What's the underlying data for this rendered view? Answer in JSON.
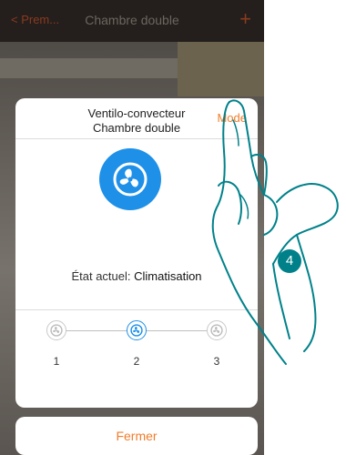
{
  "header": {
    "back_label": "< Prem...",
    "title": "Chambre double",
    "add_label": "+"
  },
  "dialog": {
    "title_line1": "Ventilo-convecteur",
    "title_line2": "Chambre double",
    "mode_label": "Mode",
    "status_label": "État actuel:",
    "status_value": "Climatisation",
    "speeds": [
      {
        "label": "1",
        "selected": false
      },
      {
        "label": "2",
        "selected": true
      },
      {
        "label": "3",
        "selected": false
      }
    ]
  },
  "close_label": "Fermer",
  "step_number": "4",
  "colors": {
    "accent": "#f07d2b",
    "fan_blue": "#1e90e8",
    "step_teal": "#00818a"
  },
  "icons": [
    "fan-icon",
    "pointing-hand"
  ]
}
